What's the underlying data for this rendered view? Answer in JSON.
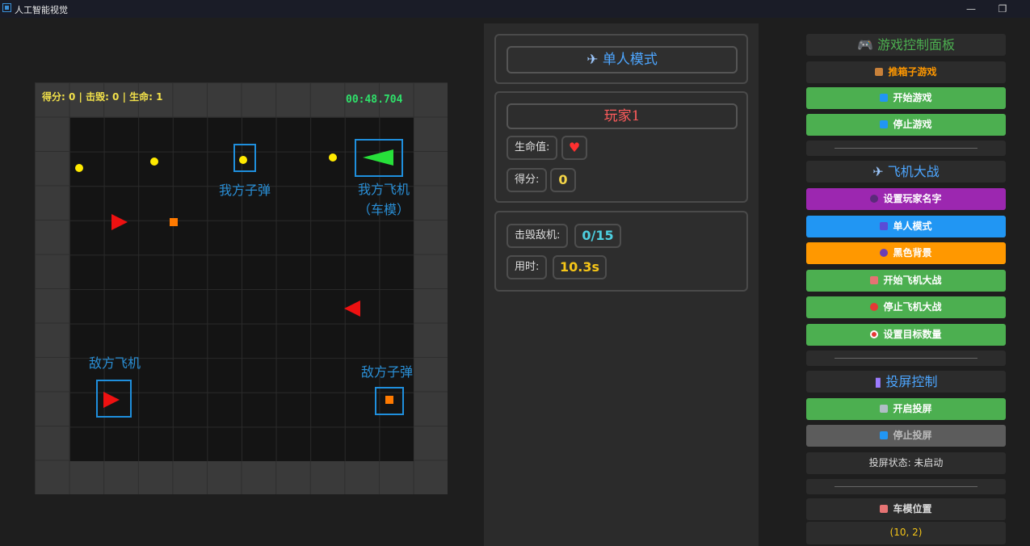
{
  "window": {
    "title": "人工智能视觉",
    "minimize": "—",
    "restore": "❐"
  },
  "game": {
    "hud": "得分: 0 | 击毁: 0 | 生命: 1",
    "timer": "00:48.704",
    "annotations": {
      "my_bullet": "我方子弹",
      "my_plane": "我方飞机\n（车模）",
      "enemy_plane": "敌方飞机",
      "enemy_bullet": "敌方子弹"
    }
  },
  "middle": {
    "mode": "单人模式",
    "player_name": "玩家1",
    "life_label": "生命值:",
    "life_value": "♥",
    "score_label": "得分:",
    "score_value": "0",
    "kills_label": "击毁敌机:",
    "kills_value": "0/15",
    "time_label": "用时:",
    "time_value": "10.3s"
  },
  "right": {
    "panel_title": "游戏控制面板",
    "sokoban_title": "推箱子游戏",
    "start_game": "开始游戏",
    "stop_game": "停止游戏",
    "plane_title": "飞机大战",
    "set_player_name": "设置玩家名字",
    "single_mode": "单人模式",
    "black_bg": "黑色背景",
    "start_plane": "开始飞机大战",
    "stop_plane": "停止飞机大战",
    "set_target": "设置目标数量",
    "cast_title": "投屏控制",
    "start_cast": "开启投屏",
    "stop_cast": "停止投屏",
    "cast_status": "投屏状态: 未启动",
    "car_pos_title": "车模位置",
    "car_pos_value": "(10, 2)"
  },
  "colors": {
    "accent_blue": "#4da6ff",
    "green_button": "#4caf50",
    "purple_button": "#9c27b0",
    "blue_button": "#2196f3",
    "orange_button": "#ff9800",
    "player_red": "#ff5c5c",
    "kills_cyan": "#4dd0e1",
    "time_yellow": "#f5c518"
  }
}
